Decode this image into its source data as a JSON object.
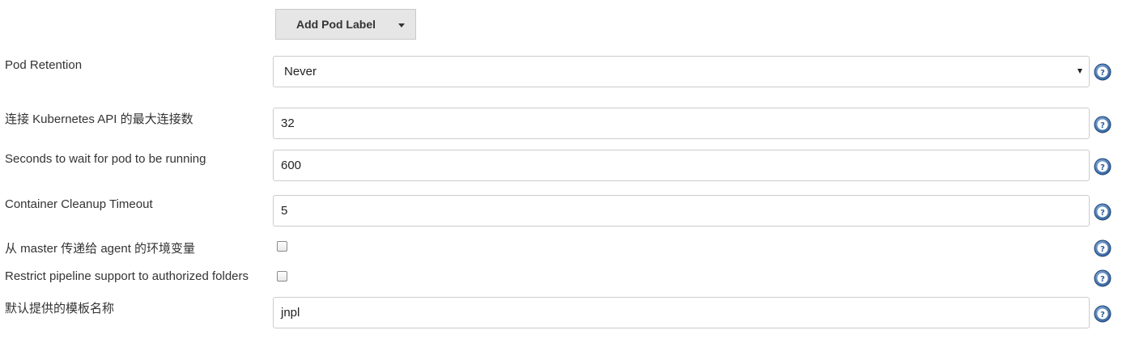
{
  "add_pod_label_button": {
    "label": "Add Pod Label"
  },
  "pod_retention": {
    "label": "Pod Retention",
    "value": "Never"
  },
  "max_connections": {
    "label": "连接 Kubernetes API 的最大连接数",
    "value": "32"
  },
  "wait_seconds": {
    "label": "Seconds to wait for pod to be running",
    "value": "600"
  },
  "cleanup_timeout": {
    "label": "Container Cleanup Timeout",
    "value": "5"
  },
  "pass_env_vars": {
    "label": "从 master 传递给 agent 的环境变量",
    "checked": false
  },
  "restrict_pipeline": {
    "label": "Restrict pipeline support to authorized folders",
    "checked": false
  },
  "default_template": {
    "label": "默认提供的模板名称",
    "value": "jnpl"
  },
  "icons": {
    "help": "help-icon",
    "dropdown": "caret-down-icon"
  },
  "colors": {
    "help_icon": "#3a6ea5",
    "button_bg": "#e6e6e6",
    "border": "#cccccc"
  }
}
